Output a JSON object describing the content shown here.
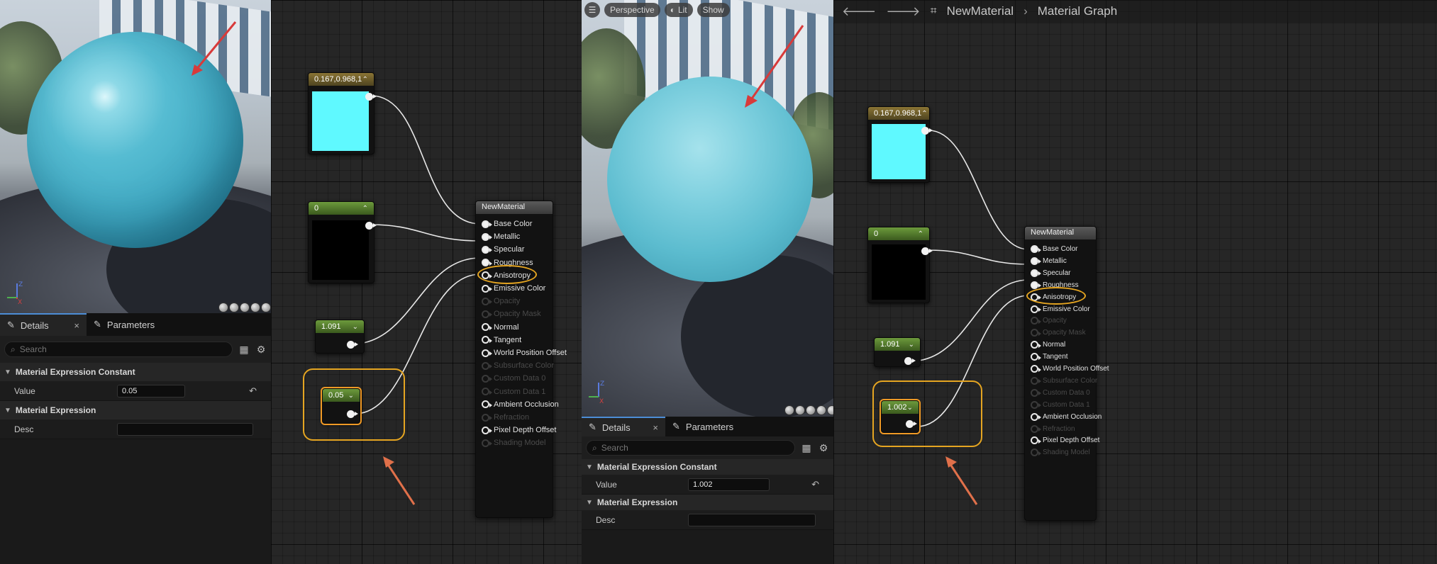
{
  "left": {
    "details_tab": "Details",
    "parameters_tab": "Parameters",
    "search_placeholder": "Search",
    "section_constant": "Material Expression Constant",
    "value_label": "Value",
    "value": "0.05",
    "section_expression": "Material Expression",
    "desc_label": "Desc",
    "desc_value": ""
  },
  "left_graph": {
    "color_node_label": "0.167,0.968,1",
    "metallic_node_label": "0",
    "specular_node_label": "1.091",
    "roughness_node_label": "0.05",
    "material_node_title": "NewMaterial"
  },
  "right": {
    "toolbar": {
      "perspective": "Perspective",
      "lit": "Lit",
      "show": "Show"
    },
    "details_tab": "Details",
    "parameters_tab": "Parameters",
    "search_placeholder": "Search",
    "section_constant": "Material Expression Constant",
    "value_label": "Value",
    "value": "1.002",
    "section_expression": "Material Expression",
    "desc_label": "Desc",
    "desc_value": ""
  },
  "right_graph": {
    "breadcrumb_root": "NewMaterial",
    "breadcrumb_child": "Material Graph",
    "color_node_label": "0.167,0.968,1",
    "metallic_node_label": "0",
    "specular_node_label": "1.091",
    "roughness_node_label": "1.002",
    "material_node_title": "NewMaterial"
  },
  "material_pins": [
    {
      "label": "Base Color",
      "enabled": true,
      "connected": true
    },
    {
      "label": "Metallic",
      "enabled": true,
      "connected": true
    },
    {
      "label": "Specular",
      "enabled": true,
      "connected": true
    },
    {
      "label": "Roughness",
      "enabled": true,
      "connected": true
    },
    {
      "label": "Anisotropy",
      "enabled": true,
      "connected": false
    },
    {
      "label": "Emissive Color",
      "enabled": true,
      "connected": false
    },
    {
      "label": "Opacity",
      "enabled": false,
      "connected": false
    },
    {
      "label": "Opacity Mask",
      "enabled": false,
      "connected": false
    },
    {
      "label": "Normal",
      "enabled": true,
      "connected": false
    },
    {
      "label": "Tangent",
      "enabled": true,
      "connected": false
    },
    {
      "label": "World Position Offset",
      "enabled": true,
      "connected": false
    },
    {
      "label": "Subsurface Color",
      "enabled": false,
      "connected": false
    },
    {
      "label": "Custom Data 0",
      "enabled": false,
      "connected": false
    },
    {
      "label": "Custom Data 1",
      "enabled": false,
      "connected": false
    },
    {
      "label": "Ambient Occlusion",
      "enabled": true,
      "connected": false
    },
    {
      "label": "Refraction",
      "enabled": false,
      "connected": false
    },
    {
      "label": "Pixel Depth Offset",
      "enabled": true,
      "connected": false
    },
    {
      "label": "Shading Model",
      "enabled": false,
      "connected": false
    }
  ],
  "colors": {
    "base_color_swatch": "#5ff9ff",
    "metallic_swatch": "#000000",
    "highlight": "#e5a521",
    "arrow": "#e0604a",
    "accent": "#4c8dd6"
  },
  "icons": [
    "pencil-icon",
    "close-icon",
    "search-icon",
    "table-view-icon",
    "settings-gear-icon",
    "reset-arrow-icon",
    "chevron-up-icon",
    "chevron-down-icon",
    "hamburger-menu-icon",
    "back-arrow-icon",
    "forward-arrow-icon",
    "graph-icon",
    "axis-gizmo-icon"
  ]
}
